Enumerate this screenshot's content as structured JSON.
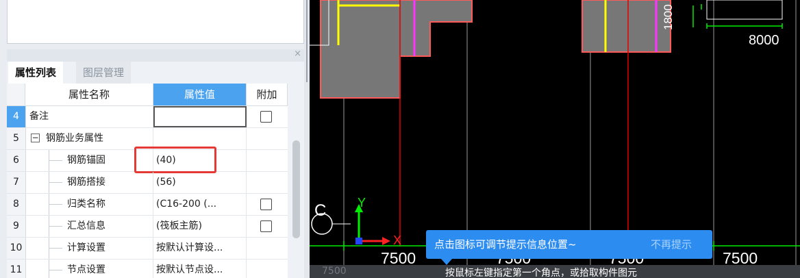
{
  "panel": {
    "close_glyph": "×",
    "tabs": [
      "属性列表",
      "图层管理"
    ],
    "columns": {
      "name": "属性名称",
      "value": "属性值",
      "extra": "附加"
    },
    "rows": [
      {
        "num": "4",
        "name": "备注",
        "value": "",
        "checkbox": true,
        "selected": true,
        "child": false
      },
      {
        "num": "5",
        "name": "钢筋业务属性",
        "value": "",
        "checkbox": false,
        "selected": false,
        "child": false,
        "group": true,
        "toggle": "−"
      },
      {
        "num": "6",
        "name": "钢筋锚固",
        "value": "(40)",
        "checkbox": false,
        "selected": false,
        "child": true,
        "highlight": true
      },
      {
        "num": "7",
        "name": "钢筋搭接",
        "value": "(56)",
        "checkbox": false,
        "selected": false,
        "child": true
      },
      {
        "num": "8",
        "name": "归类名称",
        "value": "(C16-200 (...",
        "checkbox": true,
        "selected": false,
        "child": true
      },
      {
        "num": "9",
        "name": "汇总信息",
        "value": "(筏板主筋)",
        "checkbox": true,
        "selected": false,
        "child": true
      },
      {
        "num": "10",
        "name": "计算设置",
        "value": "按默认计算设...",
        "checkbox": false,
        "selected": false,
        "child": true
      },
      {
        "num": "11",
        "name": "节点设置",
        "value": "按默认节点设...",
        "checkbox": false,
        "selected": false,
        "child": true
      }
    ]
  },
  "cad": {
    "axis_label": "C",
    "axis_y": "Y",
    "axis_x": "X",
    "dim_bottom": [
      "7500",
      "7500",
      "7500",
      "7500"
    ],
    "dim_vertical": "1800",
    "dim_right": "8000",
    "colors": {
      "slab": "#777777",
      "outline": "#ff5a5a",
      "yellow": "#ffff00",
      "magenta": "#ff33ff",
      "green": "#00ee00",
      "grid": "#9a9a9a",
      "red": "#e00000"
    }
  },
  "tip": {
    "message": "点击图标可调节提示信息位置~",
    "dismiss": "不再提示"
  },
  "status": {
    "faint": "7500",
    "text": "按鼠标左键指定第一个角点，或拾取构件图元"
  }
}
